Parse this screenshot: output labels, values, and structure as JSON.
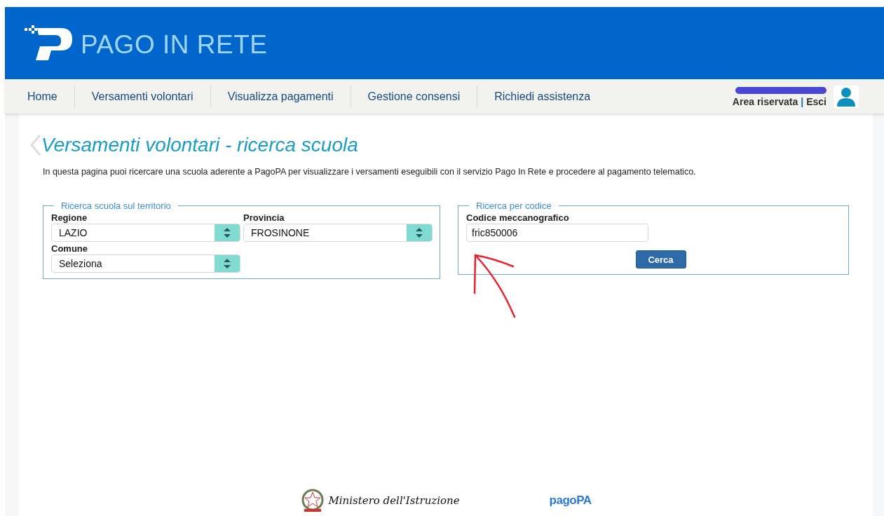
{
  "header": {
    "title": "PAGO IN RETE"
  },
  "nav": {
    "items": [
      {
        "label": "Home"
      },
      {
        "label": "Versamenti volontari"
      },
      {
        "label": "Visualizza pagamenti"
      },
      {
        "label": "Gestione consensi"
      },
      {
        "label": "Richiedi assistenza"
      }
    ],
    "user": {
      "area_link": "Area riservata",
      "separator": "|",
      "logout_link": "Esci"
    }
  },
  "page": {
    "title": "Versamenti volontari - ricerca scuola",
    "intro": "In questa pagina puoi ricercare una scuola aderente a PagoPA per visualizzare i versamenti eseguibili con il servizio Pago In Rete e procedere al pagamento telematico."
  },
  "territory_search": {
    "legend": "Ricerca scuola sul territorio",
    "fields": [
      {
        "label": "Regione",
        "value": "LAZIO"
      },
      {
        "label": "Provincia",
        "value": "FROSINONE"
      },
      {
        "label": "Comune",
        "value": "Seleziona"
      }
    ]
  },
  "code_search": {
    "legend": "Ricerca per codice",
    "label": "Codice meccanografico",
    "value": "fric850006",
    "button": "Cerca"
  },
  "footer": {
    "ministry": "Ministero dell'Istruzione",
    "pagopa": "pagoPA"
  }
}
